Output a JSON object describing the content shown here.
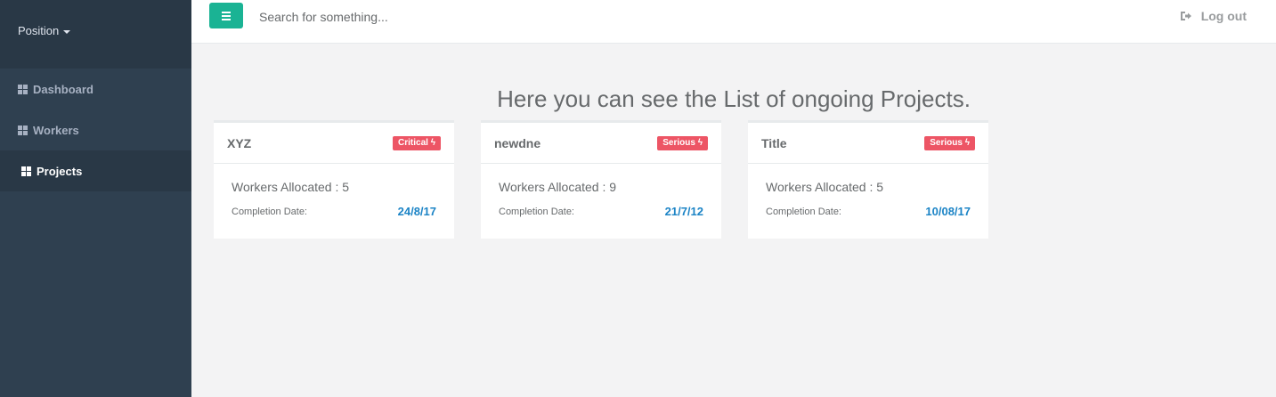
{
  "sidebar": {
    "profile_label": "Position",
    "items": [
      {
        "label": "Dashboard",
        "icon": "th-large-icon",
        "active": false
      },
      {
        "label": "Workers",
        "icon": "th-large-icon",
        "active": false
      },
      {
        "label": "Projects",
        "icon": "th-large-icon",
        "active": true
      }
    ]
  },
  "topbar": {
    "search_placeholder": "Search for something...",
    "logout_label": "Log out"
  },
  "main": {
    "heading": "Here you can see the List of ongoing Projects.",
    "projects": [
      {
        "name": "XYZ",
        "severity": "Critical",
        "workers_text": "Workers Allocated : 5",
        "completion_label": "Completion Date:",
        "completion_date": "24/8/17"
      },
      {
        "name": "newdne",
        "severity": "Serious",
        "workers_text": "Workers Allocated : 9",
        "completion_label": "Completion Date:",
        "completion_date": "21/7/12"
      },
      {
        "name": "Title",
        "severity": "Serious",
        "workers_text": "Workers Allocated : 5",
        "completion_label": "Completion Date:",
        "completion_date": "10/08/17"
      }
    ]
  },
  "colors": {
    "sidebar_bg": "#2f4050",
    "primary": "#1ab394",
    "danger": "#ed5565",
    "link": "#1c84c6"
  }
}
